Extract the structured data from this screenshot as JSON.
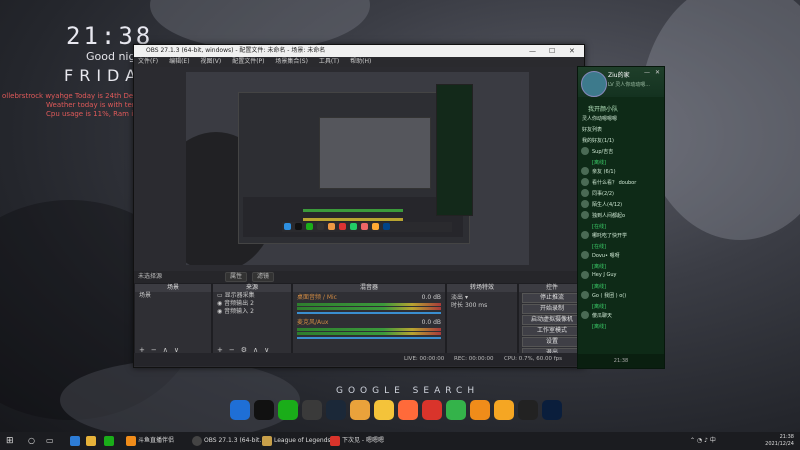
{
  "desktop": {
    "clock": "21:38",
    "greeting": "Good night",
    "day": "FRIDAY",
    "info_lines": [
      "ollebrstrock wyahge Today is 24th Decem",
      "Weather today is  with tempe",
      "Cpu usage is 11%, Ram is"
    ],
    "google_search": "GOOGLE SEARCH"
  },
  "obs": {
    "title": "OBS 27.1.3 (64-bit, windows) - 配置文件: 未命名 - 场景: 未命名",
    "window_controls": [
      "—",
      "☐",
      "✕"
    ],
    "menu": [
      "文件(F)",
      "编辑(E)",
      "视图(V)",
      "配置文件(P)",
      "场景集合(S)",
      "工具(T)",
      "帮助(H)"
    ],
    "scene_bar": {
      "label": "未选择源",
      "props_button": "属性",
      "filters_button": "滤镜"
    },
    "panels": {
      "scenes": {
        "header": "场景",
        "items": [
          "场景"
        ]
      },
      "sources": {
        "header": "来源",
        "items": [
          "显示器采集",
          "音频输出 2",
          "音频输入 2"
        ]
      },
      "mixer": {
        "header": "混音器",
        "tracks": [
          {
            "name": "桌面音频 / Mic",
            "level": "0.0 dB"
          },
          {
            "name": "麦克风/Aux",
            "level": "0.0 dB"
          }
        ]
      },
      "transitions": {
        "header": "转场特效",
        "type": "淡出",
        "duration_label": "时长",
        "duration": "300 ms"
      },
      "controls": {
        "header": "控件",
        "buttons": [
          "停止推流",
          "开始录制",
          "启动虚拟摄像机",
          "工作室模式",
          "设置",
          "退出"
        ]
      }
    },
    "status": {
      "live": "LIVE: 00:00:00",
      "rec": "REC: 00:00:00",
      "cpu": "CPU: 0.7%, 60.00 fps"
    }
  },
  "qq": {
    "name": "Ziu的家",
    "signature": "LV 灵人你动动嗯...",
    "group": "我开颜小队",
    "items": [
      {
        "text": "灵人你动嗯嗯嗯",
        "sub": false
      },
      {
        "text": "好友列表",
        "sub": false
      },
      {
        "text": "我的好友(1/1)",
        "sub": false
      },
      {
        "text": "Sup/吉吉",
        "sub": false
      },
      {
        "text": "[离线]",
        "sub": true
      },
      {
        "text": "亲友 (6/1)",
        "sub": false
      },
      {
        "text": "看什么看？ doubor",
        "sub": false
      },
      {
        "text": "同事(2/2)",
        "sub": false
      },
      {
        "text": "陌生人(4/12)",
        "sub": false
      },
      {
        "text": "独到人间都起o",
        "sub": false
      },
      {
        "text": "[在线]",
        "sub": true
      },
      {
        "text": "哪吒吃了快开学",
        "sub": false
      },
      {
        "text": "[在线]",
        "sub": true
      },
      {
        "text": "Dovu• 嗯呀",
        "sub": false
      },
      {
        "text": "[离线]",
        "sub": true
      },
      {
        "text": "Hey J Guy",
        "sub": false
      },
      {
        "text": "[离线]",
        "sub": true
      },
      {
        "text": "Go ( 我团 ) o()",
        "sub": false
      },
      {
        "text": "[离线]",
        "sub": true
      },
      {
        "text": "傻瓜聊天",
        "sub": false
      },
      {
        "text": "[离线]",
        "sub": true
      }
    ],
    "bottom": "21:38"
  },
  "taskbar": {
    "items": [
      "斗鱼直播伴侣",
      "OBS 27.1.3 (64-bit...",
      "League of Legends",
      "下次见 - 嗯嗯嗯"
    ],
    "time": "21:38",
    "date": "2021/12/24"
  },
  "colors": {
    "obs_bg": "#2b2b30",
    "qq_bg": "#0e2a17",
    "qq_accent": "#3cd06a",
    "meter_green": "#3b9a3b"
  },
  "dock_icons": [
    "windows-icon",
    "penguin-icon",
    "wechat-icon",
    "obs-icon",
    "steam-icon",
    "g-app-icon",
    "g-yellow-icon",
    "cat-icon",
    "netease-icon",
    "lol-icon",
    "fox-icon",
    "hand-icon",
    "capcut-icon",
    "photoshop-icon"
  ]
}
